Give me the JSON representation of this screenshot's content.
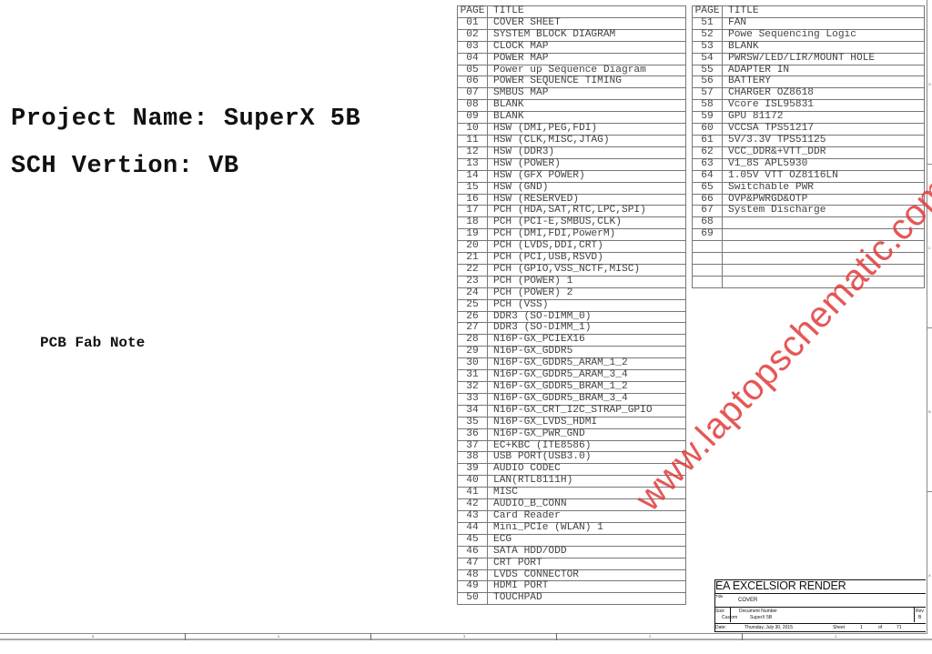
{
  "cover": {
    "project_name": "Project Name: SuperX 5B",
    "sch_version": "SCH Vertion: VB",
    "pcb_fab_note": "PCB Fab Note"
  },
  "index_left": {
    "header": {
      "page": "PAGE",
      "title": "TITLE"
    },
    "rows": [
      {
        "page": "01",
        "title": "COVER SHEET"
      },
      {
        "page": "02",
        "title": "SYSTEM BLOCK DIAGRAM"
      },
      {
        "page": "03",
        "title": "CLOCK MAP"
      },
      {
        "page": "04",
        "title": "POWER MAP"
      },
      {
        "page": "05",
        "title": "Power up Sequence Diagram"
      },
      {
        "page": "06",
        "title": "POWER SEQUENCE TIMING"
      },
      {
        "page": "07",
        "title": "SMBUS MAP"
      },
      {
        "page": "08",
        "title": "BLANK"
      },
      {
        "page": "09",
        "title": "BLANK"
      },
      {
        "page": "10",
        "title": "HSW (DMI,PEG,FDI)"
      },
      {
        "page": "11",
        "title": "HSW (CLK,MISC,JTAG)"
      },
      {
        "page": "12",
        "title": "HSW (DDR3)"
      },
      {
        "page": "13",
        "title": "HSW (POWER)"
      },
      {
        "page": "14",
        "title": "HSW (GFX POWER)"
      },
      {
        "page": "15",
        "title": "HSW (GND)"
      },
      {
        "page": "16",
        "title": "HSW (RESERVED)"
      },
      {
        "page": "17",
        "title": "PCH (HDA,SAT,RTC,LPC,SPI)"
      },
      {
        "page": "18",
        "title": "PCH (PCI-E,SMBUS,CLK)"
      },
      {
        "page": "19",
        "title": "PCH (DMI,FDI,PowerM)"
      },
      {
        "page": "20",
        "title": "PCH (LVDS,DDI,CRT)"
      },
      {
        "page": "21",
        "title": "PCH (PCI,USB,RSVD)"
      },
      {
        "page": "22",
        "title": "PCH (GPIO,VSS_NCTF,MISC)"
      },
      {
        "page": "23",
        "title": "PCH (POWER) 1"
      },
      {
        "page": "24",
        "title": "PCH (POWER) 2"
      },
      {
        "page": "25",
        "title": "PCH (VSS)"
      },
      {
        "page": "26",
        "title": "DDR3 (SO-DIMM_0)"
      },
      {
        "page": "27",
        "title": "DDR3 (SO-DIMM_1)"
      },
      {
        "page": "28",
        "title": "N16P-GX_PCIEX16"
      },
      {
        "page": "29",
        "title": "N16P-GX_GDDR5"
      },
      {
        "page": "30",
        "title": "N16P-GX_GDDR5_ARAM_1_2"
      },
      {
        "page": "31",
        "title": "N16P-GX_GDDR5_ARAM_3_4"
      },
      {
        "page": "32",
        "title": "N16P-GX_GDDR5_BRAM_1_2"
      },
      {
        "page": "33",
        "title": "N16P-GX_GDDR5_BRAM_3_4"
      },
      {
        "page": "34",
        "title": "N16P-GX_CRT_I2C_STRAP_GPIO"
      },
      {
        "page": "35",
        "title": "N16P-GX_LVDS_HDMI"
      },
      {
        "page": "36",
        "title": "N16P-GX_PWR_GND"
      },
      {
        "page": "37",
        "title": "EC+KBC (ITE8586)"
      },
      {
        "page": "38",
        "title": "USB PORT(USB3.0)"
      },
      {
        "page": "39",
        "title": "AUDIO CODEC"
      },
      {
        "page": "40",
        "title": "LAN(RTL8111H)"
      },
      {
        "page": "41",
        "title": "MISC"
      },
      {
        "page": "42",
        "title": "AUDIO_B_CONN"
      },
      {
        "page": "43",
        "title": "Card Reader"
      },
      {
        "page": "44",
        "title": "Mini_PCIe (WLAN) 1"
      },
      {
        "page": "45",
        "title": "ECG"
      },
      {
        "page": "46",
        "title": "SATA HDD/ODD"
      },
      {
        "page": "47",
        "title": "CRT PORT"
      },
      {
        "page": "48",
        "title": "LVDS CONNECTOR"
      },
      {
        "page": "49",
        "title": "HDMI PORT"
      },
      {
        "page": "50",
        "title": "TOUCHPAD"
      }
    ]
  },
  "index_right": {
    "header": {
      "page": "PAGE",
      "title": "TITLE"
    },
    "rows": [
      {
        "page": "51",
        "title": "FAN"
      },
      {
        "page": "52",
        "title": "Powe Sequencing Logic"
      },
      {
        "page": "53",
        "title": "BLANK"
      },
      {
        "page": "54",
        "title": "PWRSW/LED/LIR/MOUNT HOLE"
      },
      {
        "page": "55",
        "title": "ADAPTER IN"
      },
      {
        "page": "56",
        "title": "BATTERY"
      },
      {
        "page": "57",
        "title": "CHARGER OZ8618"
      },
      {
        "page": "58",
        "title": "Vcore ISL95831"
      },
      {
        "page": "59",
        "title": "GPU 81172"
      },
      {
        "page": "60",
        "title": "VCCSA TPS51217"
      },
      {
        "page": "61",
        "title": "5V/3.3V TPS51125"
      },
      {
        "page": "62",
        "title": "VCC_DDR&+VTT_DDR"
      },
      {
        "page": "63",
        "title": "V1_8S APL5930"
      },
      {
        "page": "64",
        "title": "1.05V VTT OZ8116LN"
      },
      {
        "page": "65",
        "title": "Switchable PWR"
      },
      {
        "page": "66",
        "title": "OVP&PWRGD&OTP"
      },
      {
        "page": "67",
        "title": "System Discharge"
      },
      {
        "page": "68",
        "title": ""
      },
      {
        "page": "69",
        "title": ""
      },
      {
        "page": "",
        "title": ""
      },
      {
        "page": "",
        "title": ""
      },
      {
        "page": "",
        "title": ""
      },
      {
        "page": "",
        "title": ""
      }
    ]
  },
  "title_block": {
    "company": "EA EXCELSIOR RENDER",
    "title_label": "Title",
    "title_value": "COVER",
    "size_label": "Size",
    "size_value": "Custom",
    "doc_number_label": "Document Number",
    "doc_number_value": "SuperX 5B",
    "rev_label": "Rev",
    "rev_value": "B",
    "date_label": "Date:",
    "date_value": "Thursday, July 30, 2015",
    "sheet_label": "Sheet",
    "sheet_value": "1",
    "of_label": "of",
    "of_value": "71"
  },
  "frame": {
    "zones_bottom": [
      "5",
      "4",
      "3",
      "2",
      "1"
    ],
    "zones_right": [
      "D",
      "C",
      "B",
      "A"
    ]
  },
  "watermark": {
    "text": "www.laptopschematic.com",
    "color": "#e23a3a"
  }
}
